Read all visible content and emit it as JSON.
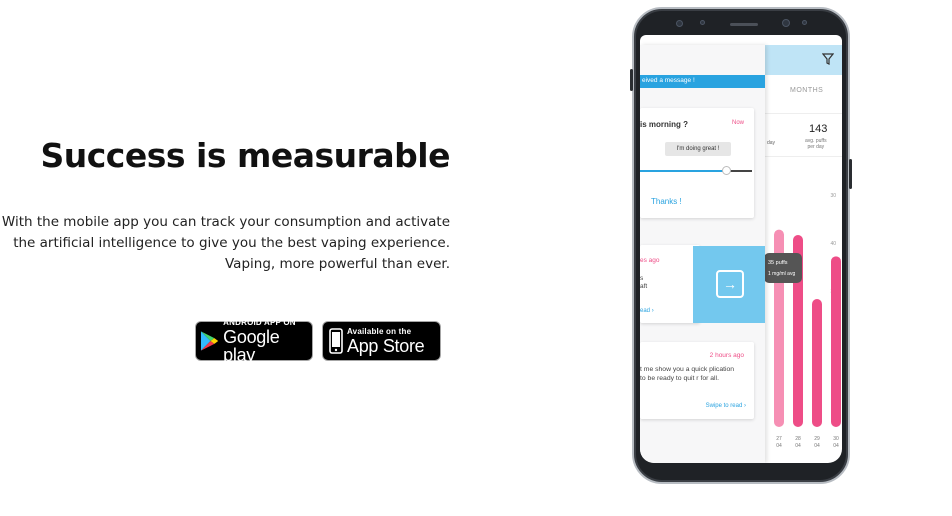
{
  "hero": {
    "title": "Success is measurable",
    "description_lines": [
      "With the mobile app you can track your consumption and activate",
      "the artificial intelligence to give you the best vaping experience.",
      "Vaping, more powerful than ever."
    ]
  },
  "stores": {
    "google": {
      "small": "ANDROID APP ON",
      "big": "Google play"
    },
    "apple": {
      "small": "Available on the",
      "big": "App Store"
    }
  },
  "phone": {
    "appbar_icon": "filter-icon",
    "tab_label": "MONTHS",
    "stat": {
      "left_text": "day",
      "value": "143",
      "label_line1": "avg. puffs",
      "label_line2": "per day"
    },
    "notification_banner": "eived a message !",
    "card_question": {
      "title": "is morning ?",
      "time": "Now",
      "reply": "I'm doing great !",
      "slider_value_pct": 78,
      "thanks": "Thanks !"
    },
    "card_mid": {
      "ago": "es ago",
      "line1": "s",
      "line2": "aft",
      "read": "ead"
    },
    "card_quit": {
      "ago": "2 hours ago",
      "body": "t me show you a quick plication to be ready to quit r for all.",
      "swipe": "Swipe to read"
    },
    "side_letter": "S",
    "accent_colors": {
      "blue": "#29a3e0",
      "pink": "#ee4d87",
      "light_pink": "#f68fb4",
      "appbar": "#bfe4f6"
    }
  },
  "chart_data": {
    "type": "bar",
    "categories": [
      "27 04",
      "28 04",
      "29 04",
      "30 04"
    ],
    "values": [
      37,
      36,
      24,
      32
    ],
    "yticks": [
      30,
      40,
      30
    ],
    "tooltip_line1": "35 puffs",
    "tooltip_line2": "1 mg/ml avg",
    "colors": [
      "#f68fb4",
      "#ee4d87",
      "#ee4d87",
      "#ee4d87"
    ],
    "ylim": [
      0,
      45
    ]
  }
}
